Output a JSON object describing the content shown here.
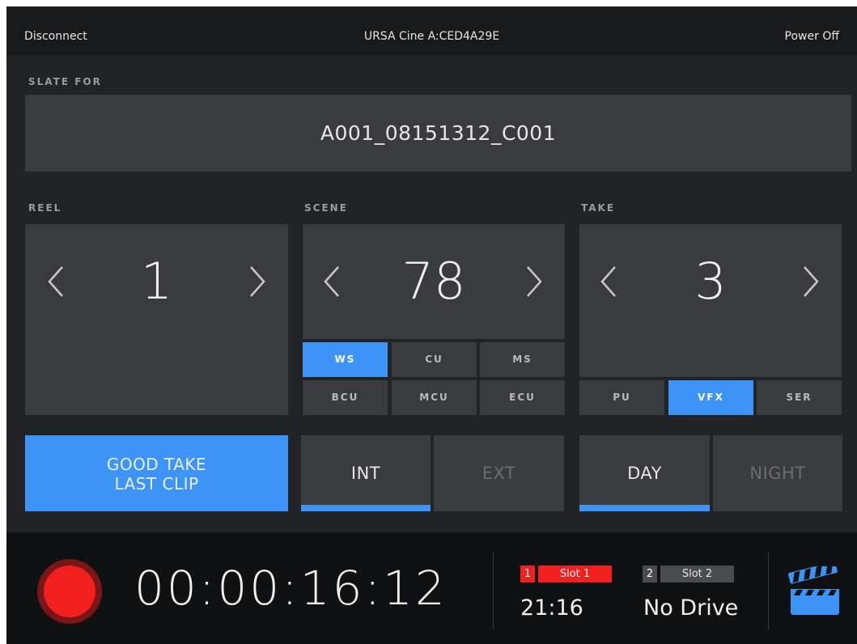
{
  "topbar": {
    "left": "Disconnect",
    "title": "URSA Cine A:CED4A29E",
    "right": "Power Off"
  },
  "slate": {
    "label": "SLATE FOR",
    "clip_name": "A001_08151312_C001"
  },
  "reel": {
    "label": "REEL",
    "value": "1"
  },
  "scene": {
    "label": "SCENE",
    "value": "78",
    "shot_types": [
      "WS",
      "CU",
      "MS",
      "BCU",
      "MCU",
      "ECU"
    ],
    "selected_shot_type": "WS"
  },
  "take": {
    "label": "TAKE",
    "value": "3",
    "flags": [
      "PU",
      "VFX",
      "SER"
    ],
    "selected_flag": "VFX"
  },
  "good_take": {
    "line1": "GOOD TAKE",
    "line2": "LAST CLIP"
  },
  "interior": {
    "int": "INT",
    "ext": "EXT",
    "selected": "INT"
  },
  "time_of_day": {
    "day": "DAY",
    "night": "NIGHT",
    "selected": "DAY"
  },
  "transport": {
    "timecode": "00:00:16:12",
    "slot1": {
      "number": "1",
      "name": "Slot 1",
      "value": "21:16",
      "color": "#f21f1f"
    },
    "slot2": {
      "number": "2",
      "name": "Slot 2",
      "value": "No Drive",
      "color": "#4a4b4e"
    }
  },
  "colors": {
    "accent": "#3d94f6",
    "record": "#f21f1f",
    "panel": "#3a3b3e",
    "background": "#222326"
  },
  "icons": [
    "chevron-left-icon",
    "chevron-right-icon",
    "record-icon",
    "clapperboard-icon"
  ]
}
